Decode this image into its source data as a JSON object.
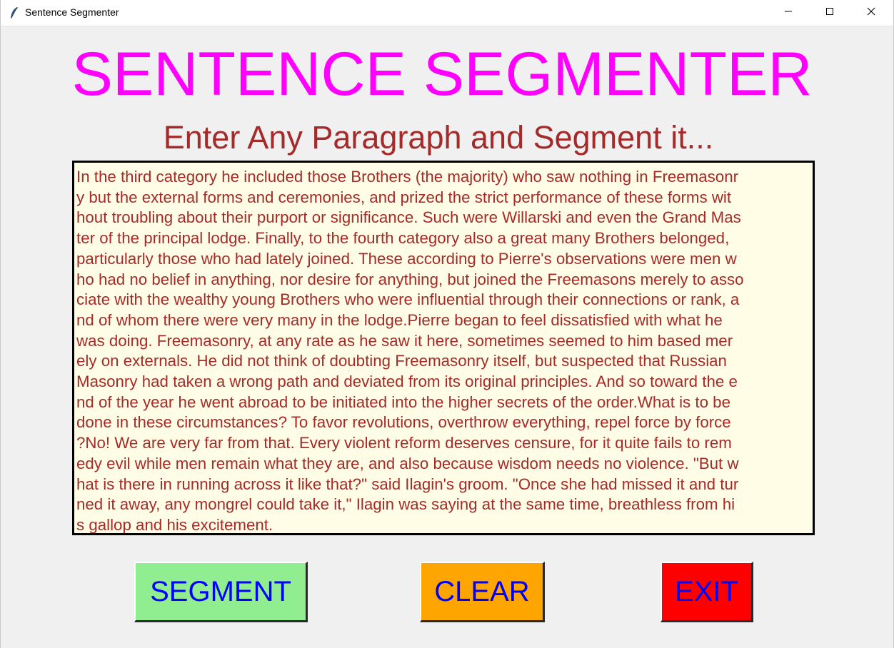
{
  "window": {
    "title": "Sentence Segmenter",
    "icon": "feather-icon",
    "controls": [
      "minimize-icon",
      "maximize-icon",
      "close-icon"
    ]
  },
  "heading": "SENTENCE SEGMENTER",
  "subheading": "Enter Any Paragraph and Segment it...",
  "textbox": {
    "value": "In the third category he included those Brothers (the majority) who saw nothing in Freemasonry but the external forms and ceremonies, and prized the strict performance of these forms without troubling about their purport or significance. Such were Willarski and even the Grand Master of the principal lodge. Finally, to the fourth category also a great many Brothers belonged, particularly those who had lately joined. These according to Pierre's observations were men who had no belief in anything, nor desire for anything, but joined the Freemasons merely to associate with the wealthy young Brothers who were influential through their connections or rank, and of whom there were very many in the lodge.Pierre began to feel dissatisfied with what he was doing. Freemasonry, at any rate as he saw it here, sometimes seemed to him based merely on externals. He did not think of doubting Freemasonry itself, but suspected that Russian Masonry had taken a wrong path and deviated from its original principles. And so toward the end of the year he went abroad to be initiated into the higher secrets of the order.What is to be done in these circumstances? To favor revolutions, overthrow everything, repel force by force?No! We are very far from that. Every violent reform deserves censure, for it quite fails to remedy evil while men remain what they are, and also because wisdom needs no violence. \"But what is there in running across it like that?\" said Ilagin's groom. \"Once she had missed it and turned it away, any mongrel could take it,\" Ilagin was saying at the same time, breathless from his gallop and his excitement.",
    "lines": [
      "In the third category he included those Brothers (the majority) who saw nothing in Freemasonr",
      "y but the external forms and ceremonies, and prized the strict performance of these forms wit",
      "hout troubling about their purport or significance. Such were Willarski and even the Grand Mas",
      "ter of the principal lodge. Finally, to the fourth category also a great many Brothers belonged,",
      "particularly those who had lately joined. These according to Pierre's observations were men w",
      "ho had no belief in anything, nor desire for anything, but joined the Freemasons merely to asso",
      "ciate with the wealthy young Brothers who were influential through their connections or rank, a",
      "nd of whom there were very many in the lodge.Pierre began to feel dissatisfied with what he",
      "was doing. Freemasonry, at any rate as he saw it here, sometimes seemed to him based mer",
      "ely on externals. He did not think of doubting Freemasonry itself, but suspected that Russian",
      "Masonry had taken a wrong path and deviated from its original principles. And so toward the e",
      "nd of the year he went abroad to be initiated into the higher secrets of the order.What is to be",
      "done in these circumstances? To favor revolutions, overthrow everything, repel force by force",
      "?No! We are very far from that. Every violent reform deserves censure, for it quite fails to rem",
      "edy evil while men remain what they are, and also because wisdom needs no violence. \"But w",
      "hat is there in running across it like that?\" said Ilagin's groom. \"Once she had missed it and tur",
      "ned it away, any mongrel could take it,\" Ilagin was saying at the same time, breathless from hi",
      "s gallop and his excitement."
    ]
  },
  "buttons": {
    "segment": "SEGMENT",
    "clear": "CLEAR",
    "exit": "EXIT"
  },
  "colors": {
    "heading": "#ff00ff",
    "subheading": "#a52a2a",
    "text": "#a52a2a",
    "textbox_bg": "#fffde6",
    "segment_bg": "#90ee90",
    "clear_bg": "#ffa500",
    "exit_bg": "#ff0000",
    "button_text": "#0000ff"
  }
}
